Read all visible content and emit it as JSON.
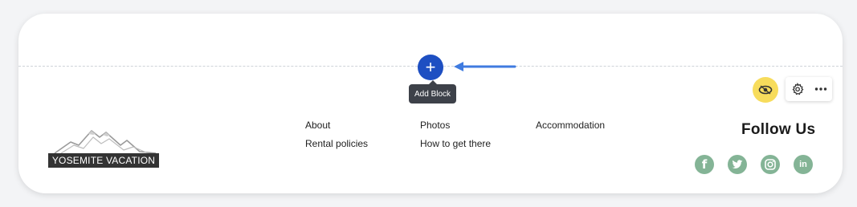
{
  "editor": {
    "add_block_tooltip": "Add Block",
    "add_icon": "plus-icon",
    "accent_color": "#1e4fc2",
    "arrow_color": "#3f7be0",
    "visibility_icon": "eye-icon",
    "settings_icon": "gear-icon",
    "more_icon": "more-horizontal-icon",
    "visibility_button_color": "#f7dc5c"
  },
  "footer": {
    "logo_text": "YOSEMITE VACATION",
    "links": [
      "About",
      "Rental policies",
      "Photos",
      "How to get there",
      "Accommodation"
    ],
    "follow_title": "Follow Us",
    "social_color": "#84b496",
    "social": [
      {
        "icon": "facebook-icon",
        "glyph": "f"
      },
      {
        "icon": "twitter-icon",
        "glyph": ""
      },
      {
        "icon": "instagram-icon",
        "glyph": ""
      },
      {
        "icon": "linkedin-icon",
        "glyph": "in"
      }
    ]
  }
}
